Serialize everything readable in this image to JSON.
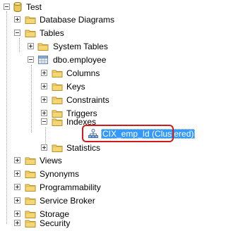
{
  "tree": {
    "root": {
      "label": "Test",
      "icon": "database-icon",
      "expanded": true
    },
    "items": [
      {
        "label": "Database Diagrams",
        "icon": "folder-icon",
        "expanded": false
      },
      {
        "label": "Tables",
        "icon": "folder-icon",
        "expanded": true
      },
      {
        "label": "System Tables",
        "icon": "folder-icon",
        "expanded": false
      },
      {
        "label": "dbo.employee",
        "icon": "table-icon",
        "expanded": true
      },
      {
        "label": "Columns",
        "icon": "folder-icon",
        "expanded": false
      },
      {
        "label": "Keys",
        "icon": "folder-icon",
        "expanded": false
      },
      {
        "label": "Constraints",
        "icon": "folder-icon",
        "expanded": false
      },
      {
        "label": "Triggers",
        "icon": "folder-icon",
        "expanded": false
      },
      {
        "label": "Indexes",
        "icon": "folder-icon",
        "expanded": true
      },
      {
        "label": "CIX_emp_Id (Clustered)",
        "icon": "clustered-index-icon",
        "selected": true
      },
      {
        "label": "Statistics",
        "icon": "folder-icon",
        "expanded": false
      },
      {
        "label": "Views",
        "icon": "folder-icon",
        "expanded": false
      },
      {
        "label": "Synonyms",
        "icon": "folder-icon",
        "expanded": false
      },
      {
        "label": "Programmability",
        "icon": "folder-icon",
        "expanded": false
      },
      {
        "label": "Service Broker",
        "icon": "folder-icon",
        "expanded": false
      },
      {
        "label": "Storage",
        "icon": "folder-icon",
        "expanded": false
      },
      {
        "label": "Security",
        "icon": "folder-icon",
        "expanded": false
      }
    ]
  },
  "colors": {
    "selection": "#3399ff",
    "highlight_ring": "#d11a1a",
    "folder": "#e8c65a"
  }
}
